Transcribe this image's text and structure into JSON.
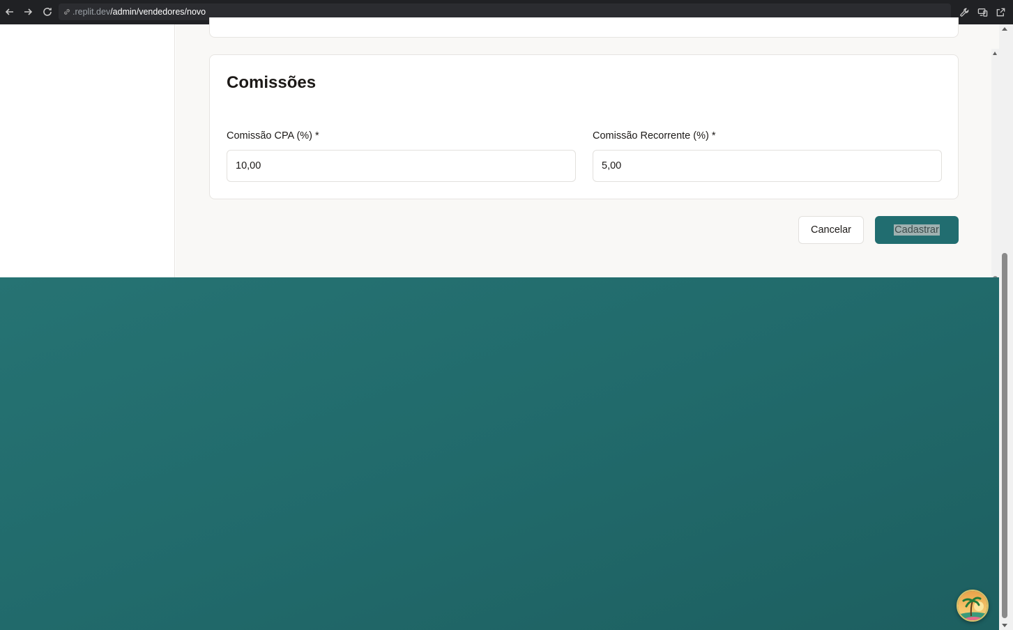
{
  "browser": {
    "url_host": ".replit.dev",
    "url_path": "/admin/vendedores/novo",
    "icons": [
      "back-arrow-icon",
      "forward-arrow-icon",
      "reload-icon",
      "link-icon",
      "wrench-icon",
      "devices-icon",
      "open-external-icon"
    ]
  },
  "section": {
    "title": "Comissões"
  },
  "fields": {
    "cpa": {
      "label": "Comissão CPA (%) *",
      "value": "10,00"
    },
    "recurring": {
      "label": "Comissão Recorrente (%) *",
      "value": "5,00"
    }
  },
  "actions": {
    "cancel_label": "Cancelar",
    "submit_label": "Cadastrar"
  },
  "colors": {
    "primary": "#216d70",
    "background_teal": "#216a6b",
    "surface": "#f9f8f6"
  },
  "avatar": {
    "icon": "palm-tree-beach-avatar"
  }
}
